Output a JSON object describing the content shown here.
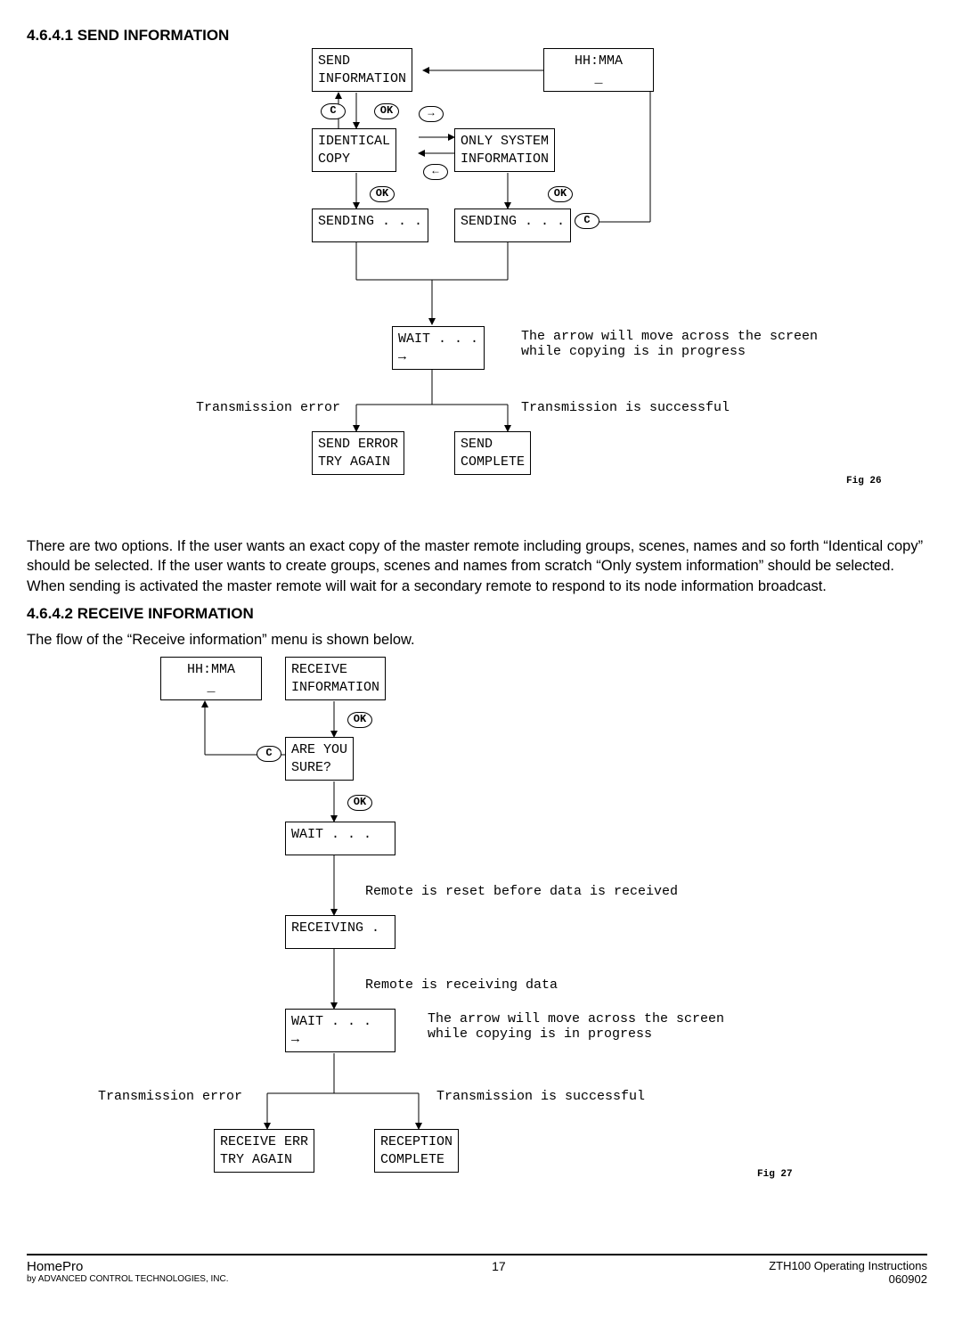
{
  "sections": {
    "h1": "4.6.4.1 SEND INFORMATION",
    "p1": "There are two options. If the user wants an exact copy of the master remote including groups, scenes, names and so forth “Identical copy” should be selected. If the user wants to create groups, scenes and names from scratch “Only system information” should be selected. When sending is activated the master remote will wait for a secondary remote to respond to its node information broadcast.",
    "h2": "4.6.4.2  RECEIVE  INFORMATION",
    "p2": "The flow of the “Receive information” menu is shown below."
  },
  "diagram1": {
    "boxes": {
      "sendInfo": "SEND\nINFORMATION",
      "time": "HH:MMA\n_",
      "identical": "IDENTICAL\nCOPY",
      "onlySys": "ONLY SYSTEM\nINFORMATION",
      "sending1": "SENDING . . .",
      "sending2": "SENDING . . .",
      "wait": "WAIT . . .\n→",
      "sendErr": "SEND ERROR\nTRY AGAIN",
      "sendComplete": "SEND\nCOMPLETE"
    },
    "labels": {
      "arrowNote": "The arrow will move across the screen\nwhile copying is in progress",
      "txErr": "Transmission error",
      "txOk": "Transmission is successful",
      "fig": "Fig 26"
    },
    "btns": {
      "c": "C",
      "ok": "OK"
    }
  },
  "diagram2": {
    "boxes": {
      "time": "HH:MMA\n_",
      "recvInfo": "RECEIVE\nINFORMATION",
      "sure": "ARE YOU\nSURE?",
      "wait1": "WAIT . . .",
      "receiving": "RECEIVING .",
      "wait2": "WAIT . . .\n→",
      "recvErr": "RECEIVE ERR\nTRY AGAIN",
      "recvComplete": "RECEPTION\nCOMPLETE"
    },
    "labels": {
      "resetNote": "Remote is reset before data is received",
      "recvNote": "Remote is receiving data",
      "arrowNote": "The arrow will move across the screen\nwhile copying is in progress",
      "txErr": "Transmission error",
      "txOk": "Transmission is successful",
      "fig": "Fig 27"
    },
    "btns": {
      "c": "C",
      "ok": "OK"
    }
  },
  "footer": {
    "brand": "HomePro",
    "byline": "by ADVANCED CONTROL TECHNOLOGIES, INC.",
    "page": "17",
    "docTitle": "ZTH100 Operating Instructions",
    "docRev": "060902"
  }
}
